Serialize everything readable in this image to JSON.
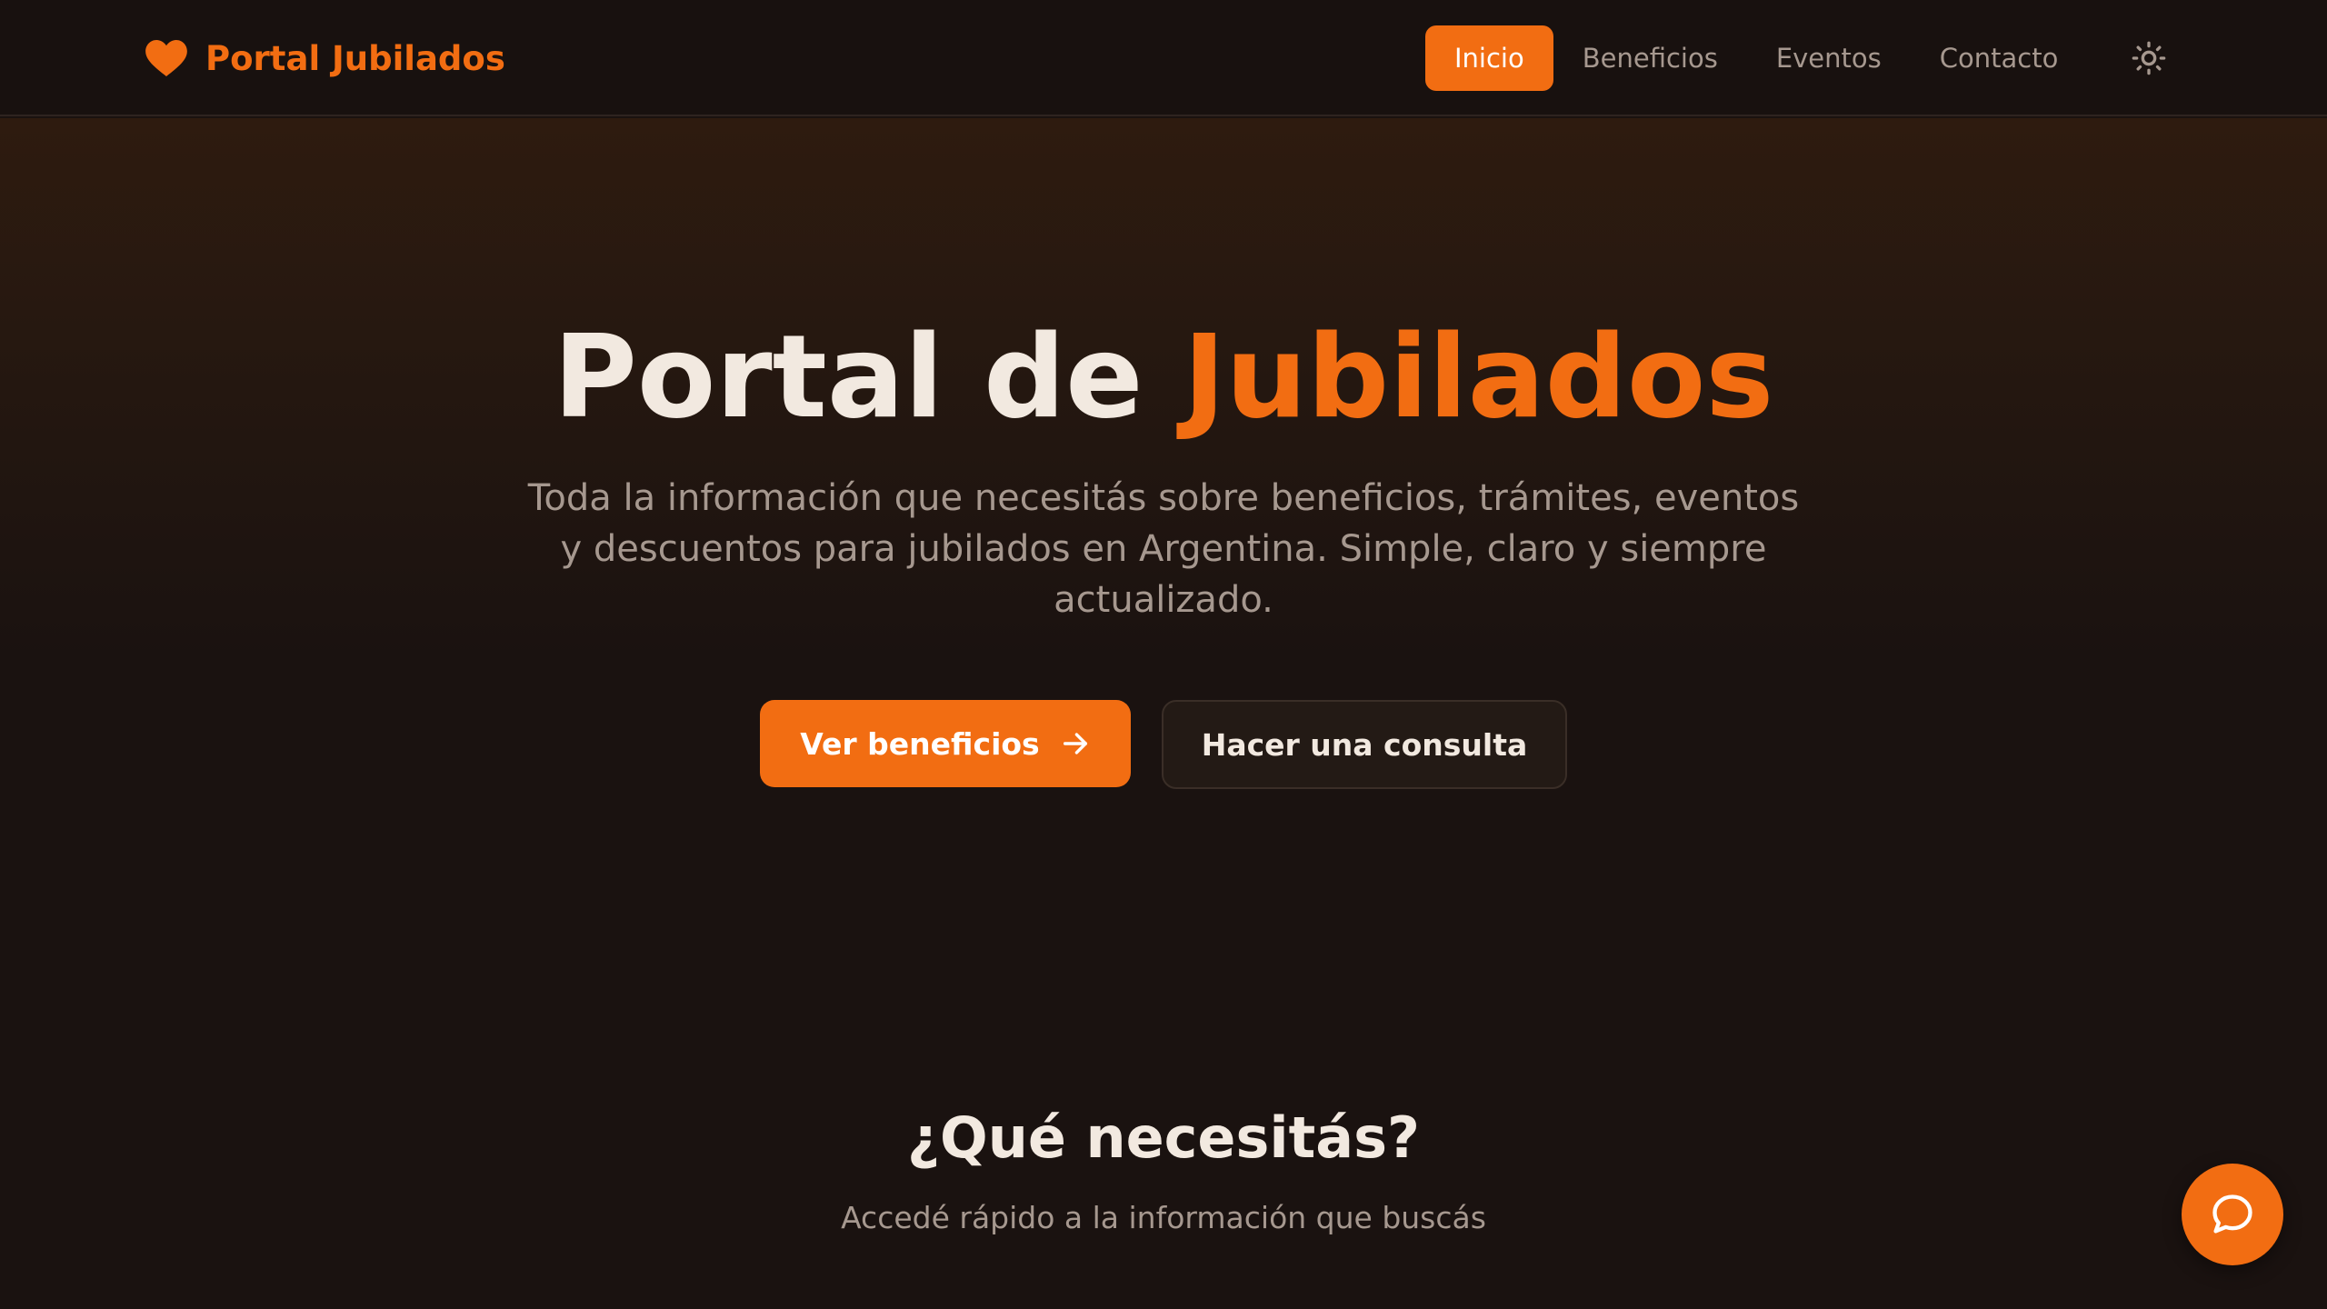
{
  "header": {
    "brand_name": "Portal Jubilados",
    "nav": [
      {
        "label": "Inicio",
        "active": true
      },
      {
        "label": "Beneficios",
        "active": false
      },
      {
        "label": "Eventos",
        "active": false
      },
      {
        "label": "Contacto",
        "active": false
      }
    ],
    "theme_icon": "sun-icon"
  },
  "hero": {
    "title_prefix": "Portal de ",
    "title_accent": "Jubilados",
    "subtitle": "Toda la información que necesitás sobre beneficios, trámites, eventos y descuentos para jubilados en Argentina. Simple, claro y siempre actualizado.",
    "primary_button": "Ver beneficios",
    "secondary_button": "Hacer una consulta"
  },
  "section": {
    "title": "¿Qué necesitás?",
    "subtitle": "Accedé rápido a la información que buscás"
  },
  "chat": {
    "icon": "chat-bubble-icon"
  },
  "colors": {
    "accent": "#f26d12",
    "background": "#1a1210",
    "text": "#f2e9e0",
    "muted": "#a6988f"
  }
}
